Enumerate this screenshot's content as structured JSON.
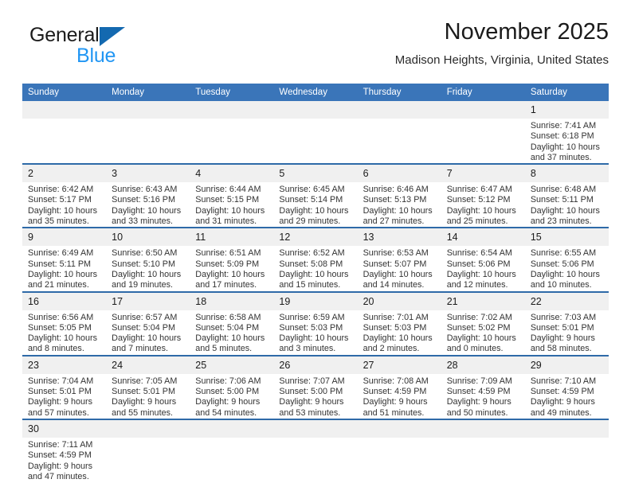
{
  "branding": {
    "logo_primary": "General",
    "logo_secondary": "Blue",
    "logo_primary_color": "#1b1b1b",
    "logo_secondary_color": "#2196f3",
    "logo_triangle_color": "#1469b0",
    "icon": "general-blue-logo"
  },
  "header": {
    "title": "November 2025",
    "subtitle": "Madison Heights, Virginia, United States"
  },
  "theme": {
    "header_background": "#3a75b9",
    "header_text": "#ffffff",
    "row_separator": "#2e6aa8",
    "daynum_background": "#f0f0f0",
    "body_text": "#333333"
  },
  "calendar": {
    "weekday_headers": [
      "Sunday",
      "Monday",
      "Tuesday",
      "Wednesday",
      "Thursday",
      "Friday",
      "Saturday"
    ],
    "weeks": [
      [
        {
          "day": "",
          "blank": true,
          "sunrise": "",
          "sunset": "",
          "daylight_line1": "",
          "daylight_line2": ""
        },
        {
          "day": "",
          "blank": true,
          "sunrise": "",
          "sunset": "",
          "daylight_line1": "",
          "daylight_line2": ""
        },
        {
          "day": "",
          "blank": true,
          "sunrise": "",
          "sunset": "",
          "daylight_line1": "",
          "daylight_line2": ""
        },
        {
          "day": "",
          "blank": true,
          "sunrise": "",
          "sunset": "",
          "daylight_line1": "",
          "daylight_line2": ""
        },
        {
          "day": "",
          "blank": true,
          "sunrise": "",
          "sunset": "",
          "daylight_line1": "",
          "daylight_line2": ""
        },
        {
          "day": "",
          "blank": true,
          "sunrise": "",
          "sunset": "",
          "daylight_line1": "",
          "daylight_line2": ""
        },
        {
          "day": "1",
          "blank": false,
          "sunrise": "Sunrise: 7:41 AM",
          "sunset": "Sunset: 6:18 PM",
          "daylight_line1": "Daylight: 10 hours",
          "daylight_line2": "and 37 minutes."
        }
      ],
      [
        {
          "day": "2",
          "blank": false,
          "sunrise": "Sunrise: 6:42 AM",
          "sunset": "Sunset: 5:17 PM",
          "daylight_line1": "Daylight: 10 hours",
          "daylight_line2": "and 35 minutes."
        },
        {
          "day": "3",
          "blank": false,
          "sunrise": "Sunrise: 6:43 AM",
          "sunset": "Sunset: 5:16 PM",
          "daylight_line1": "Daylight: 10 hours",
          "daylight_line2": "and 33 minutes."
        },
        {
          "day": "4",
          "blank": false,
          "sunrise": "Sunrise: 6:44 AM",
          "sunset": "Sunset: 5:15 PM",
          "daylight_line1": "Daylight: 10 hours",
          "daylight_line2": "and 31 minutes."
        },
        {
          "day": "5",
          "blank": false,
          "sunrise": "Sunrise: 6:45 AM",
          "sunset": "Sunset: 5:14 PM",
          "daylight_line1": "Daylight: 10 hours",
          "daylight_line2": "and 29 minutes."
        },
        {
          "day": "6",
          "blank": false,
          "sunrise": "Sunrise: 6:46 AM",
          "sunset": "Sunset: 5:13 PM",
          "daylight_line1": "Daylight: 10 hours",
          "daylight_line2": "and 27 minutes."
        },
        {
          "day": "7",
          "blank": false,
          "sunrise": "Sunrise: 6:47 AM",
          "sunset": "Sunset: 5:12 PM",
          "daylight_line1": "Daylight: 10 hours",
          "daylight_line2": "and 25 minutes."
        },
        {
          "day": "8",
          "blank": false,
          "sunrise": "Sunrise: 6:48 AM",
          "sunset": "Sunset: 5:11 PM",
          "daylight_line1": "Daylight: 10 hours",
          "daylight_line2": "and 23 minutes."
        }
      ],
      [
        {
          "day": "9",
          "blank": false,
          "sunrise": "Sunrise: 6:49 AM",
          "sunset": "Sunset: 5:11 PM",
          "daylight_line1": "Daylight: 10 hours",
          "daylight_line2": "and 21 minutes."
        },
        {
          "day": "10",
          "blank": false,
          "sunrise": "Sunrise: 6:50 AM",
          "sunset": "Sunset: 5:10 PM",
          "daylight_line1": "Daylight: 10 hours",
          "daylight_line2": "and 19 minutes."
        },
        {
          "day": "11",
          "blank": false,
          "sunrise": "Sunrise: 6:51 AM",
          "sunset": "Sunset: 5:09 PM",
          "daylight_line1": "Daylight: 10 hours",
          "daylight_line2": "and 17 minutes."
        },
        {
          "day": "12",
          "blank": false,
          "sunrise": "Sunrise: 6:52 AM",
          "sunset": "Sunset: 5:08 PM",
          "daylight_line1": "Daylight: 10 hours",
          "daylight_line2": "and 15 minutes."
        },
        {
          "day": "13",
          "blank": false,
          "sunrise": "Sunrise: 6:53 AM",
          "sunset": "Sunset: 5:07 PM",
          "daylight_line1": "Daylight: 10 hours",
          "daylight_line2": "and 14 minutes."
        },
        {
          "day": "14",
          "blank": false,
          "sunrise": "Sunrise: 6:54 AM",
          "sunset": "Sunset: 5:06 PM",
          "daylight_line1": "Daylight: 10 hours",
          "daylight_line2": "and 12 minutes."
        },
        {
          "day": "15",
          "blank": false,
          "sunrise": "Sunrise: 6:55 AM",
          "sunset": "Sunset: 5:06 PM",
          "daylight_line1": "Daylight: 10 hours",
          "daylight_line2": "and 10 minutes."
        }
      ],
      [
        {
          "day": "16",
          "blank": false,
          "sunrise": "Sunrise: 6:56 AM",
          "sunset": "Sunset: 5:05 PM",
          "daylight_line1": "Daylight: 10 hours",
          "daylight_line2": "and 8 minutes."
        },
        {
          "day": "17",
          "blank": false,
          "sunrise": "Sunrise: 6:57 AM",
          "sunset": "Sunset: 5:04 PM",
          "daylight_line1": "Daylight: 10 hours",
          "daylight_line2": "and 7 minutes."
        },
        {
          "day": "18",
          "blank": false,
          "sunrise": "Sunrise: 6:58 AM",
          "sunset": "Sunset: 5:04 PM",
          "daylight_line1": "Daylight: 10 hours",
          "daylight_line2": "and 5 minutes."
        },
        {
          "day": "19",
          "blank": false,
          "sunrise": "Sunrise: 6:59 AM",
          "sunset": "Sunset: 5:03 PM",
          "daylight_line1": "Daylight: 10 hours",
          "daylight_line2": "and 3 minutes."
        },
        {
          "day": "20",
          "blank": false,
          "sunrise": "Sunrise: 7:01 AM",
          "sunset": "Sunset: 5:03 PM",
          "daylight_line1": "Daylight: 10 hours",
          "daylight_line2": "and 2 minutes."
        },
        {
          "day": "21",
          "blank": false,
          "sunrise": "Sunrise: 7:02 AM",
          "sunset": "Sunset: 5:02 PM",
          "daylight_line1": "Daylight: 10 hours",
          "daylight_line2": "and 0 minutes."
        },
        {
          "day": "22",
          "blank": false,
          "sunrise": "Sunrise: 7:03 AM",
          "sunset": "Sunset: 5:01 PM",
          "daylight_line1": "Daylight: 9 hours",
          "daylight_line2": "and 58 minutes."
        }
      ],
      [
        {
          "day": "23",
          "blank": false,
          "sunrise": "Sunrise: 7:04 AM",
          "sunset": "Sunset: 5:01 PM",
          "daylight_line1": "Daylight: 9 hours",
          "daylight_line2": "and 57 minutes."
        },
        {
          "day": "24",
          "blank": false,
          "sunrise": "Sunrise: 7:05 AM",
          "sunset": "Sunset: 5:01 PM",
          "daylight_line1": "Daylight: 9 hours",
          "daylight_line2": "and 55 minutes."
        },
        {
          "day": "25",
          "blank": false,
          "sunrise": "Sunrise: 7:06 AM",
          "sunset": "Sunset: 5:00 PM",
          "daylight_line1": "Daylight: 9 hours",
          "daylight_line2": "and 54 minutes."
        },
        {
          "day": "26",
          "blank": false,
          "sunrise": "Sunrise: 7:07 AM",
          "sunset": "Sunset: 5:00 PM",
          "daylight_line1": "Daylight: 9 hours",
          "daylight_line2": "and 53 minutes."
        },
        {
          "day": "27",
          "blank": false,
          "sunrise": "Sunrise: 7:08 AM",
          "sunset": "Sunset: 4:59 PM",
          "daylight_line1": "Daylight: 9 hours",
          "daylight_line2": "and 51 minutes."
        },
        {
          "day": "28",
          "blank": false,
          "sunrise": "Sunrise: 7:09 AM",
          "sunset": "Sunset: 4:59 PM",
          "daylight_line1": "Daylight: 9 hours",
          "daylight_line2": "and 50 minutes."
        },
        {
          "day": "29",
          "blank": false,
          "sunrise": "Sunrise: 7:10 AM",
          "sunset": "Sunset: 4:59 PM",
          "daylight_line1": "Daylight: 9 hours",
          "daylight_line2": "and 49 minutes."
        }
      ],
      [
        {
          "day": "30",
          "blank": false,
          "sunrise": "Sunrise: 7:11 AM",
          "sunset": "Sunset: 4:59 PM",
          "daylight_line1": "Daylight: 9 hours",
          "daylight_line2": "and 47 minutes."
        },
        {
          "day": "",
          "blank": true,
          "sunrise": "",
          "sunset": "",
          "daylight_line1": "",
          "daylight_line2": ""
        },
        {
          "day": "",
          "blank": true,
          "sunrise": "",
          "sunset": "",
          "daylight_line1": "",
          "daylight_line2": ""
        },
        {
          "day": "",
          "blank": true,
          "sunrise": "",
          "sunset": "",
          "daylight_line1": "",
          "daylight_line2": ""
        },
        {
          "day": "",
          "blank": true,
          "sunrise": "",
          "sunset": "",
          "daylight_line1": "",
          "daylight_line2": ""
        },
        {
          "day": "",
          "blank": true,
          "sunrise": "",
          "sunset": "",
          "daylight_line1": "",
          "daylight_line2": ""
        },
        {
          "day": "",
          "blank": true,
          "sunrise": "",
          "sunset": "",
          "daylight_line1": "",
          "daylight_line2": ""
        }
      ]
    ]
  }
}
